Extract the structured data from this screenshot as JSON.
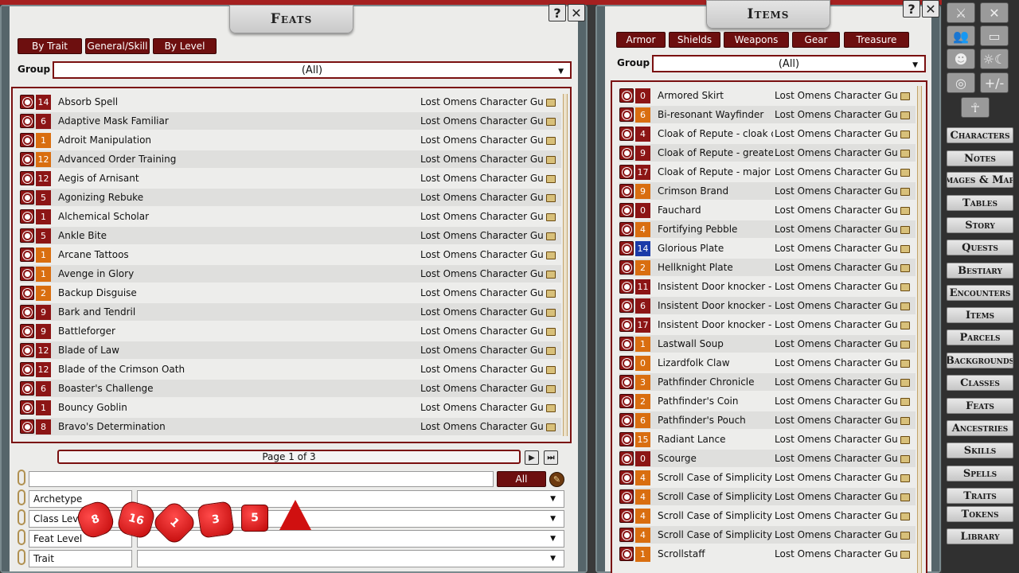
{
  "feats_window": {
    "title": "Feats",
    "help": "?",
    "close": "✕",
    "tabs": [
      "By Trait",
      "General/Skill",
      "By Level"
    ],
    "group_label": "Group",
    "group_value": "(All)",
    "rows": [
      {
        "level": "14",
        "color": "#8c1515",
        "name": "Absorb Spell",
        "source": "Lost Omens Character Guid"
      },
      {
        "level": "6",
        "color": "#8c1515",
        "name": "Adaptive Mask Familiar",
        "source": "Lost Omens Character Guid"
      },
      {
        "level": "1",
        "color": "#d96e10",
        "name": "Adroit Manipulation",
        "source": "Lost Omens Character Guid"
      },
      {
        "level": "12",
        "color": "#d96e10",
        "name": "Advanced Order Training",
        "source": "Lost Omens Character Guid"
      },
      {
        "level": "12",
        "color": "#8c1515",
        "name": "Aegis of Arnisant",
        "source": "Lost Omens Character Guid"
      },
      {
        "level": "5",
        "color": "#8c1515",
        "name": "Agonizing Rebuke",
        "source": "Lost Omens Character Guid"
      },
      {
        "level": "1",
        "color": "#8c1515",
        "name": "Alchemical Scholar",
        "source": "Lost Omens Character Guid"
      },
      {
        "level": "5",
        "color": "#8c1515",
        "name": "Ankle Bite",
        "source": "Lost Omens Character Guid"
      },
      {
        "level": "1",
        "color": "#d96e10",
        "name": "Arcane Tattoos",
        "source": "Lost Omens Character Guid"
      },
      {
        "level": "1",
        "color": "#d96e10",
        "name": "Avenge in Glory",
        "source": "Lost Omens Character Guid"
      },
      {
        "level": "2",
        "color": "#d96e10",
        "name": "Backup Disguise",
        "source": "Lost Omens Character Guid"
      },
      {
        "level": "9",
        "color": "#8c1515",
        "name": "Bark and Tendril",
        "source": "Lost Omens Character Guid"
      },
      {
        "level": "9",
        "color": "#8c1515",
        "name": "Battleforger",
        "source": "Lost Omens Character Guid"
      },
      {
        "level": "12",
        "color": "#8c1515",
        "name": "Blade of Law",
        "source": "Lost Omens Character Guid"
      },
      {
        "level": "12",
        "color": "#8c1515",
        "name": "Blade of the Crimson Oath",
        "source": "Lost Omens Character Guid"
      },
      {
        "level": "6",
        "color": "#8c1515",
        "name": "Boaster's Challenge",
        "source": "Lost Omens Character Guid"
      },
      {
        "level": "1",
        "color": "#8c1515",
        "name": "Bouncy Goblin",
        "source": "Lost Omens Character Guid"
      },
      {
        "level": "8",
        "color": "#8c1515",
        "name": "Bravo's Determination",
        "source": "Lost Omens Character Guid"
      }
    ],
    "page_text": "Page 1 of 3",
    "all_button": "All",
    "filters": [
      "Archetype",
      "Class Level",
      "Feat Level",
      "Trait"
    ]
  },
  "items_window": {
    "title": "Items",
    "help": "?",
    "close": "✕",
    "tabs": [
      "Armor",
      "Shields",
      "Weapons",
      "Gear",
      "Treasure"
    ],
    "group_label": "Group",
    "group_value": "(All)",
    "rows": [
      {
        "level": "0",
        "color": "#8c1515",
        "name": "Armored Skirt",
        "source": "Lost Omens Character Guid"
      },
      {
        "level": "6",
        "color": "#d96e10",
        "name": "Bi-resonant Wayfinder",
        "source": "Lost Omens Character Guid"
      },
      {
        "level": "4",
        "color": "#8c1515",
        "name": "Cloak of Repute - cloak of r",
        "source": "Lost Omens Character Guid"
      },
      {
        "level": "9",
        "color": "#8c1515",
        "name": "Cloak of Repute - greater c",
        "source": "Lost Omens Character Guid"
      },
      {
        "level": "17",
        "color": "#8c1515",
        "name": "Cloak of Repute - major clo",
        "source": "Lost Omens Character Guid"
      },
      {
        "level": "9",
        "color": "#d96e10",
        "name": "Crimson Brand",
        "source": "Lost Omens Character Guid"
      },
      {
        "level": "0",
        "color": "#8c1515",
        "name": "Fauchard",
        "source": "Lost Omens Character Guid"
      },
      {
        "level": "4",
        "color": "#d96e10",
        "name": "Fortifying Pebble",
        "source": "Lost Omens Character Guid"
      },
      {
        "level": "14",
        "color": "#1a3aa8",
        "name": "Glorious Plate",
        "source": "Lost Omens Character Guid"
      },
      {
        "level": "2",
        "color": "#d96e10",
        "name": "Hellknight Plate",
        "source": "Lost Omens Character Guid"
      },
      {
        "level": "11",
        "color": "#8c1515",
        "name": "Insistent Door knocker - gr",
        "source": "Lost Omens Character Guid"
      },
      {
        "level": "6",
        "color": "#8c1515",
        "name": "Insistent Door knocker - in:",
        "source": "Lost Omens Character Guid"
      },
      {
        "level": "17",
        "color": "#8c1515",
        "name": "Insistent Door knocker - m",
        "source": "Lost Omens Character Guid"
      },
      {
        "level": "1",
        "color": "#d96e10",
        "name": "Lastwall Soup",
        "source": "Lost Omens Character Guid"
      },
      {
        "level": "0",
        "color": "#d96e10",
        "name": "Lizardfolk Claw",
        "source": "Lost Omens Character Guid"
      },
      {
        "level": "3",
        "color": "#d96e10",
        "name": "Pathfinder Chronicle",
        "source": "Lost Omens Character Guid"
      },
      {
        "level": "2",
        "color": "#d96e10",
        "name": "Pathfinder's Coin",
        "source": "Lost Omens Character Guid"
      },
      {
        "level": "6",
        "color": "#d96e10",
        "name": "Pathfinder's Pouch",
        "source": "Lost Omens Character Guid"
      },
      {
        "level": "15",
        "color": "#d96e10",
        "name": "Radiant Lance",
        "source": "Lost Omens Character Guid"
      },
      {
        "level": "0",
        "color": "#8c1515",
        "name": "Scourge",
        "source": "Lost Omens Character Guid"
      },
      {
        "level": "4",
        "color": "#d96e10",
        "name": "Scroll Case of Simplicity - a",
        "source": "Lost Omens Character Guid"
      },
      {
        "level": "4",
        "color": "#d96e10",
        "name": "Scroll Case of Simplicity - d",
        "source": "Lost Omens Character Guid"
      },
      {
        "level": "4",
        "color": "#d96e10",
        "name": "Scroll Case of Simplicity - o",
        "source": "Lost Omens Character Guid"
      },
      {
        "level": "4",
        "color": "#d96e10",
        "name": "Scroll Case of Simplicity - p",
        "source": "Lost Omens Character Guid"
      },
      {
        "level": "1",
        "color": "#d96e10",
        "name": "Scrollstaff",
        "source": "Lost Omens Character Guid"
      }
    ]
  },
  "dice": [
    "8",
    "16",
    "1",
    "3",
    "5",
    ""
  ],
  "sidebar": {
    "tools": [
      "⚔",
      "✕",
      "👥",
      "▭",
      "☻",
      "☼☾",
      "◎",
      "+/-",
      "☥"
    ],
    "items": [
      "Characters",
      "Notes",
      "Images & Maps",
      "Tables",
      "Story",
      "Quests",
      "Bestiary",
      "Encounters",
      "Items",
      "Parcels",
      "Backgrounds",
      "Classes",
      "Feats",
      "Ancestries",
      "Skills",
      "Spells",
      "Traits",
      "Tokens",
      "Library"
    ]
  }
}
